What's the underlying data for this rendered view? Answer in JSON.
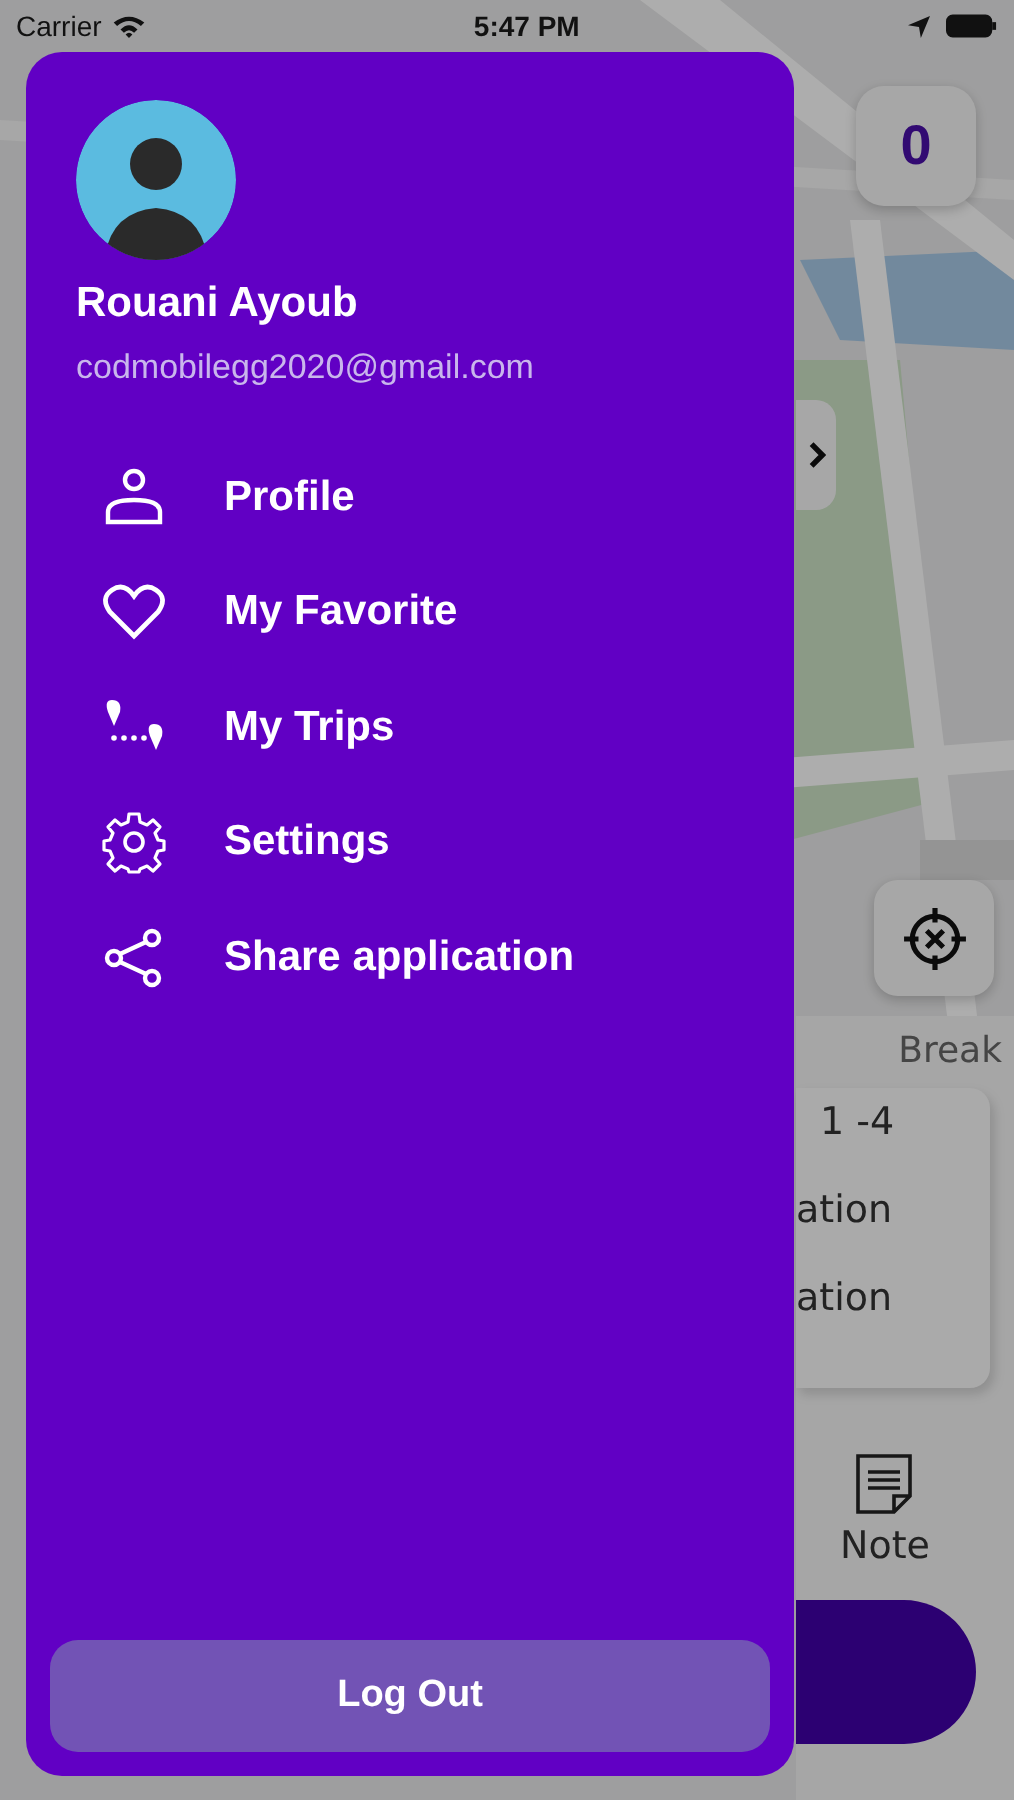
{
  "status_bar": {
    "carrier": "Carrier",
    "time": "5:47 PM"
  },
  "map_screen": {
    "counter": "0",
    "break_label": "Break",
    "card": {
      "title": "1 -4",
      "lines": [
        "ation",
        "ation"
      ]
    },
    "note_label": "Note"
  },
  "drawer": {
    "user": {
      "name": "Rouani Ayoub",
      "email": "codmobilegg2020@gmail.com"
    },
    "menu": [
      {
        "label": "Profile"
      },
      {
        "label": "My Favorite"
      },
      {
        "label": "My Trips"
      },
      {
        "label": "Settings"
      },
      {
        "label": "Share application"
      }
    ],
    "logout": "Log Out"
  }
}
